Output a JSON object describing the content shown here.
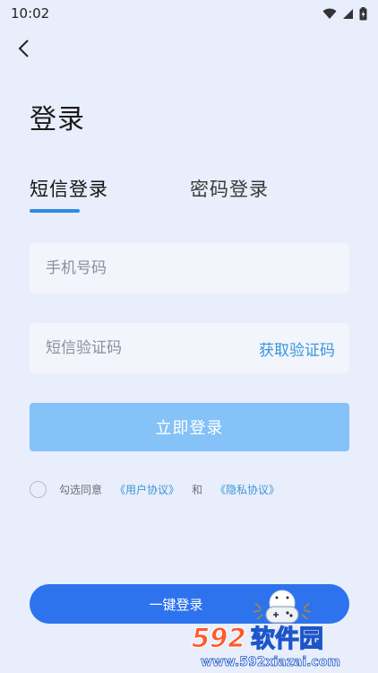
{
  "status_bar": {
    "time": "10:02"
  },
  "page": {
    "title": "登录"
  },
  "tabs": [
    {
      "label": "短信登录",
      "active": true
    },
    {
      "label": "密码登录",
      "active": false
    }
  ],
  "form": {
    "phone_placeholder": "手机号码",
    "code_placeholder": "短信验证码",
    "get_code_label": "获取验证码",
    "submit_label": "立即登录"
  },
  "agreement": {
    "prefix": "勾选同意",
    "user_agreement": "《用户协议》",
    "and": "和",
    "privacy_agreement": "《隐私协议》"
  },
  "one_click": {
    "label": "一键登录"
  },
  "watermark": {
    "brand": "592软件园",
    "url": "www.592xiazai.com"
  },
  "colors": {
    "background": "#e8eefb",
    "accent": "#2d8ce4",
    "link": "#3a95d9",
    "submit_disabled": "#84c2f7",
    "one_click": "#2d73ee"
  }
}
